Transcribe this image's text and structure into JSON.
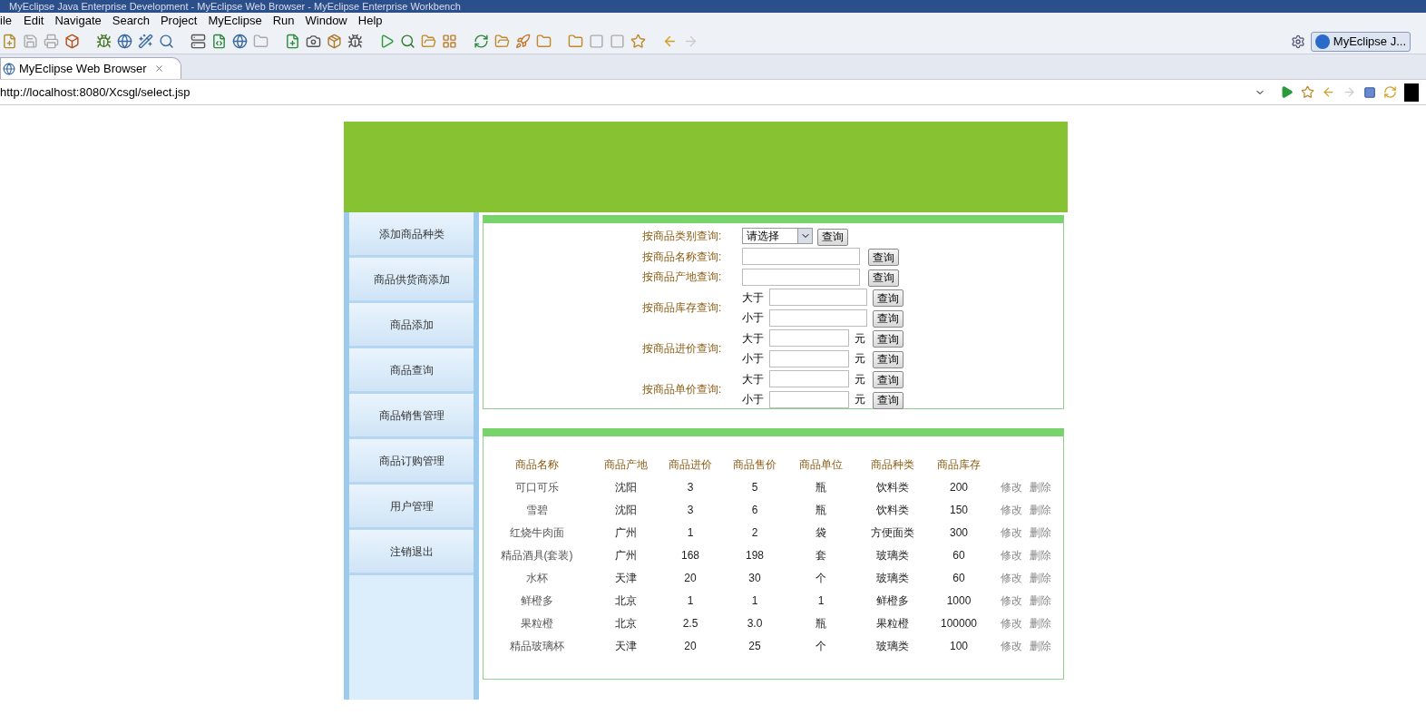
{
  "window": {
    "title": "MyEclipse Java Enterprise Development - MyEclipse Web Browser - MyEclipse Enterprise Workbench"
  },
  "menu": [
    "ile",
    "Edit",
    "Navigate",
    "Search",
    "Project",
    "MyEclipse",
    "Run",
    "Window",
    "Help"
  ],
  "perspective": {
    "label": "MyEclipse J..."
  },
  "editor_tab": {
    "title": "MyEclipse Web Browser"
  },
  "address": {
    "value": "http://localhost:8080/Xcsgl/select.jsp"
  },
  "sidebar": {
    "items": [
      "添加商品种类",
      "商品供货商添加",
      "商品添加",
      "商品查询",
      "商品销售管理",
      "商品订购管理",
      "用户管理",
      "注销退出"
    ]
  },
  "search": {
    "rows": [
      {
        "kind": "select",
        "label": "按商品类别查询:",
        "value": "请选择",
        "button": "查询"
      },
      {
        "kind": "text",
        "label": "按商品名称查询:",
        "button": "查询"
      },
      {
        "kind": "text",
        "label": "按商品产地查询:",
        "button": "查询"
      },
      {
        "kind": "range",
        "label": "按商品库存查询:",
        "bounds": [
          {
            "prefix": "大于",
            "button": "查询"
          },
          {
            "prefix": "小于",
            "button": "查询"
          }
        ]
      },
      {
        "kind": "range",
        "label": "按商品进价查询:",
        "bounds": [
          {
            "prefix": "大于",
            "suffix": "元",
            "button": "查询"
          },
          {
            "prefix": "小于",
            "suffix": "元",
            "button": "查询"
          }
        ]
      },
      {
        "kind": "range",
        "label": "按商品单价查询:",
        "bounds": [
          {
            "prefix": "大于",
            "suffix": "元",
            "button": "查询"
          },
          {
            "prefix": "小于",
            "suffix": "元",
            "button": "查询"
          }
        ]
      }
    ]
  },
  "table": {
    "columns": [
      "商品名称",
      "商品产地",
      "商品进价",
      "商品售价",
      "商品单位",
      "商品种类",
      "商品库存"
    ],
    "rows": [
      {
        "cells": [
          "可口可乐",
          "沈阳",
          "3",
          "5",
          "瓶",
          "饮料类",
          "200"
        ],
        "actions": [
          "修改",
          "删除"
        ]
      },
      {
        "cells": [
          "雪碧",
          "沈阳",
          "3",
          "6",
          "瓶",
          "饮料类",
          "150"
        ],
        "actions": [
          "修改",
          "删除"
        ]
      },
      {
        "cells": [
          "红烧牛肉面",
          "广州",
          "1",
          "2",
          "袋",
          "方便面类",
          "300"
        ],
        "actions": [
          "修改",
          "删除"
        ]
      },
      {
        "cells": [
          "精品酒具(套装)",
          "广州",
          "168",
          "198",
          "套",
          "玻璃类",
          "60"
        ],
        "actions": [
          "修改",
          "删除"
        ]
      },
      {
        "cells": [
          "水杯",
          "天津",
          "20",
          "30",
          "个",
          "玻璃类",
          "60"
        ],
        "actions": [
          "修改",
          "删除"
        ]
      },
      {
        "cells": [
          "鲜橙多",
          "北京",
          "1",
          "1",
          "1",
          "鲜橙多",
          "1000"
        ],
        "actions": [
          "修改",
          "删除"
        ]
      },
      {
        "cells": [
          "果粒橙",
          "北京",
          "2.5",
          "3.0",
          "瓶",
          "果粒橙",
          "100000"
        ],
        "actions": [
          "修改",
          "删除"
        ]
      },
      {
        "cells": [
          "精品玻璃杯",
          "天津",
          "20",
          "25",
          "个",
          "玻璃类",
          "100"
        ],
        "actions": [
          "修改",
          "删除"
        ]
      }
    ]
  }
}
